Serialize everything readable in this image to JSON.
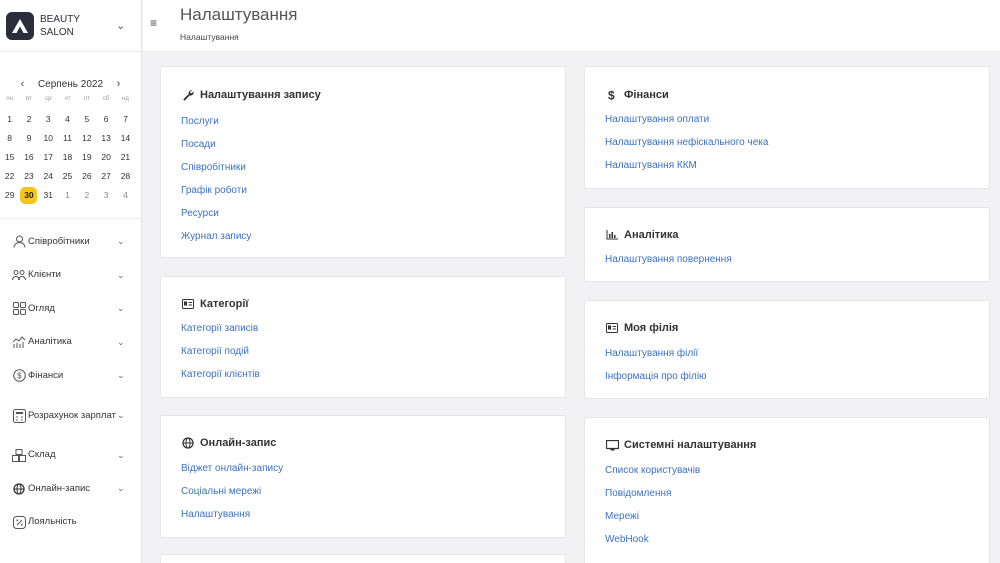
{
  "brand": {
    "line1": "BEAUTY",
    "line2": "SALON"
  },
  "calendar": {
    "month": "Серпень 2022",
    "weekdays": [
      "пн",
      "вт",
      "ср",
      "чт",
      "пт",
      "сб",
      "нд"
    ],
    "weeks": [
      [
        "1",
        "2",
        "3",
        "4",
        "5",
        "6",
        "7"
      ],
      [
        "8",
        "9",
        "10",
        "11",
        "12",
        "13",
        "14"
      ],
      [
        "15",
        "16",
        "17",
        "18",
        "19",
        "20",
        "21"
      ],
      [
        "22",
        "23",
        "24",
        "25",
        "26",
        "27",
        "28"
      ],
      [
        "29",
        "30",
        "31",
        "1",
        "2",
        "3",
        "4"
      ]
    ],
    "today": "30"
  },
  "menu": [
    {
      "label": "Співробітники",
      "icon": "person-icon"
    },
    {
      "label": "Клієнти",
      "icon": "people-icon"
    },
    {
      "label": "Огляд",
      "icon": "grid-icon"
    },
    {
      "label": "Аналітика",
      "icon": "analytics-icon"
    },
    {
      "label": "Фінанси",
      "icon": "coin-icon"
    },
    {
      "label": "Розрахунок зарплат",
      "icon": "calculator-icon"
    },
    {
      "label": "Склад",
      "icon": "warehouse-icon"
    },
    {
      "label": "Онлайн-запис",
      "icon": "globe-icon"
    },
    {
      "label": "Лояльність",
      "icon": "percent-icon"
    }
  ],
  "header": {
    "title": "Налаштування",
    "breadcrumb": "Налаштування"
  },
  "cards": {
    "booking": {
      "title": "Налаштування запису",
      "icon": "wrench-icon",
      "links": [
        "Послуги",
        "Посади",
        "Співробітники",
        "Графік роботи",
        "Ресурси",
        "Журнал запису"
      ]
    },
    "categories": {
      "title": "Категорії",
      "icon": "id-card-icon",
      "links": [
        "Категорії записів",
        "Категорії подій",
        "Категорії клієнтів"
      ]
    },
    "online": {
      "title": "Онлайн-запис",
      "icon": "globe-icon",
      "links": [
        "Віджет онлайн-запису",
        "Соціальні мережі",
        "Налаштування"
      ]
    },
    "finance": {
      "title": "Фінанси",
      "icon": "dollar-icon",
      "links": [
        "Налаштування оплати",
        "Налаштування нефіскального чека",
        "Налаштування ККМ"
      ]
    },
    "analytics": {
      "title": "Аналітика",
      "icon": "bar-chart-icon",
      "links": [
        "Налаштування повернення"
      ]
    },
    "branch": {
      "title": "Моя філія",
      "icon": "id-card-icon",
      "links": [
        "Налаштування філії",
        "Інформація про філію"
      ]
    },
    "system": {
      "title": "Системні налаштування",
      "icon": "monitor-icon",
      "links": [
        "Список користувачів",
        "Повідомлення",
        "Мережі",
        "WebHook"
      ]
    }
  }
}
